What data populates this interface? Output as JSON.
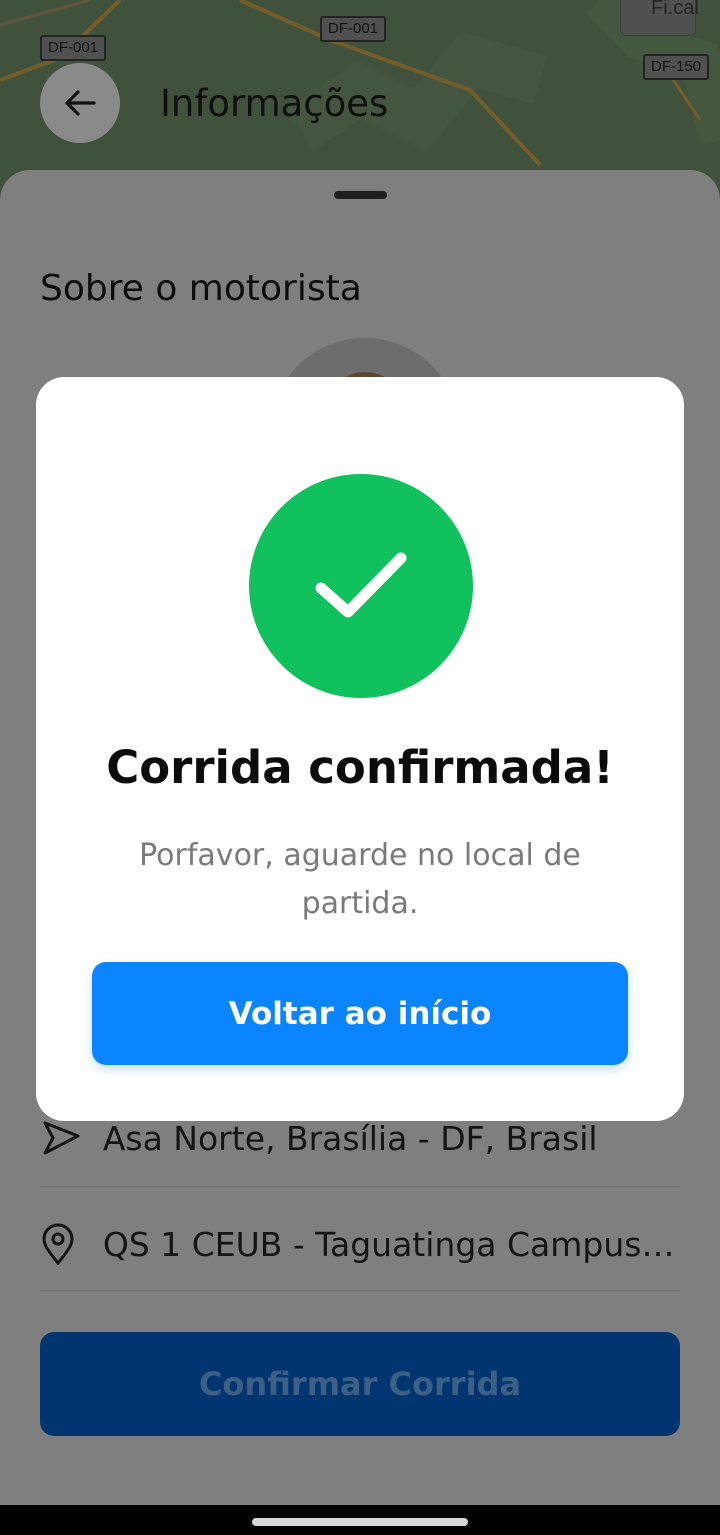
{
  "map": {
    "road_labels": [
      "DF-001",
      "DF-001",
      "DF-150"
    ],
    "control_text": "Fi.cal"
  },
  "header": {
    "title": "Informações",
    "back_icon": "arrow-left-icon"
  },
  "sheet": {
    "heading": "Sobre o motorista",
    "origin": "Asa Norte, Brasília - DF, Brasil",
    "destination": "QS 1 CEUB - Taguatinga Campus II ...",
    "confirm_label": "Confirmar Corrida"
  },
  "modal": {
    "icon": "check-icon",
    "title": "Corrida confirmada!",
    "message": "Porfavor, aguarde no local de partida.",
    "button_label": "Voltar ao início"
  },
  "colors": {
    "success": "#11c15e",
    "primary": "#0a84ff",
    "confirm_dimmed": "#00356f"
  }
}
